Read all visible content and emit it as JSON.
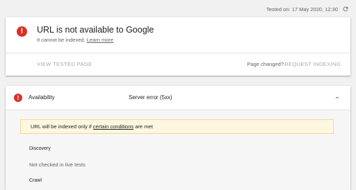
{
  "header": {
    "tested_on": "Tested on: 17 May 2020, 12:30"
  },
  "result": {
    "title": "URL is not available to Google",
    "subtitle_prefix": "It cannot be indexed.",
    "learn_more": "Learn more",
    "view_tested_page": "VIEW TESTED PAGE",
    "page_changed": "Page changed?",
    "request_indexing": "REQUEST INDEXING"
  },
  "availability": {
    "label": "Availability",
    "value": "Server error (5xx)",
    "notice_prefix": "URL will be indexed only if",
    "notice_link": "certain conditions",
    "notice_suffix": "are met",
    "discovery_label": "Discovery",
    "discovery_value": "Not checked in live tests",
    "next_label": "Crawl"
  },
  "colors": {
    "error": "#d93025",
    "notice_bg": "#fef7e0"
  }
}
